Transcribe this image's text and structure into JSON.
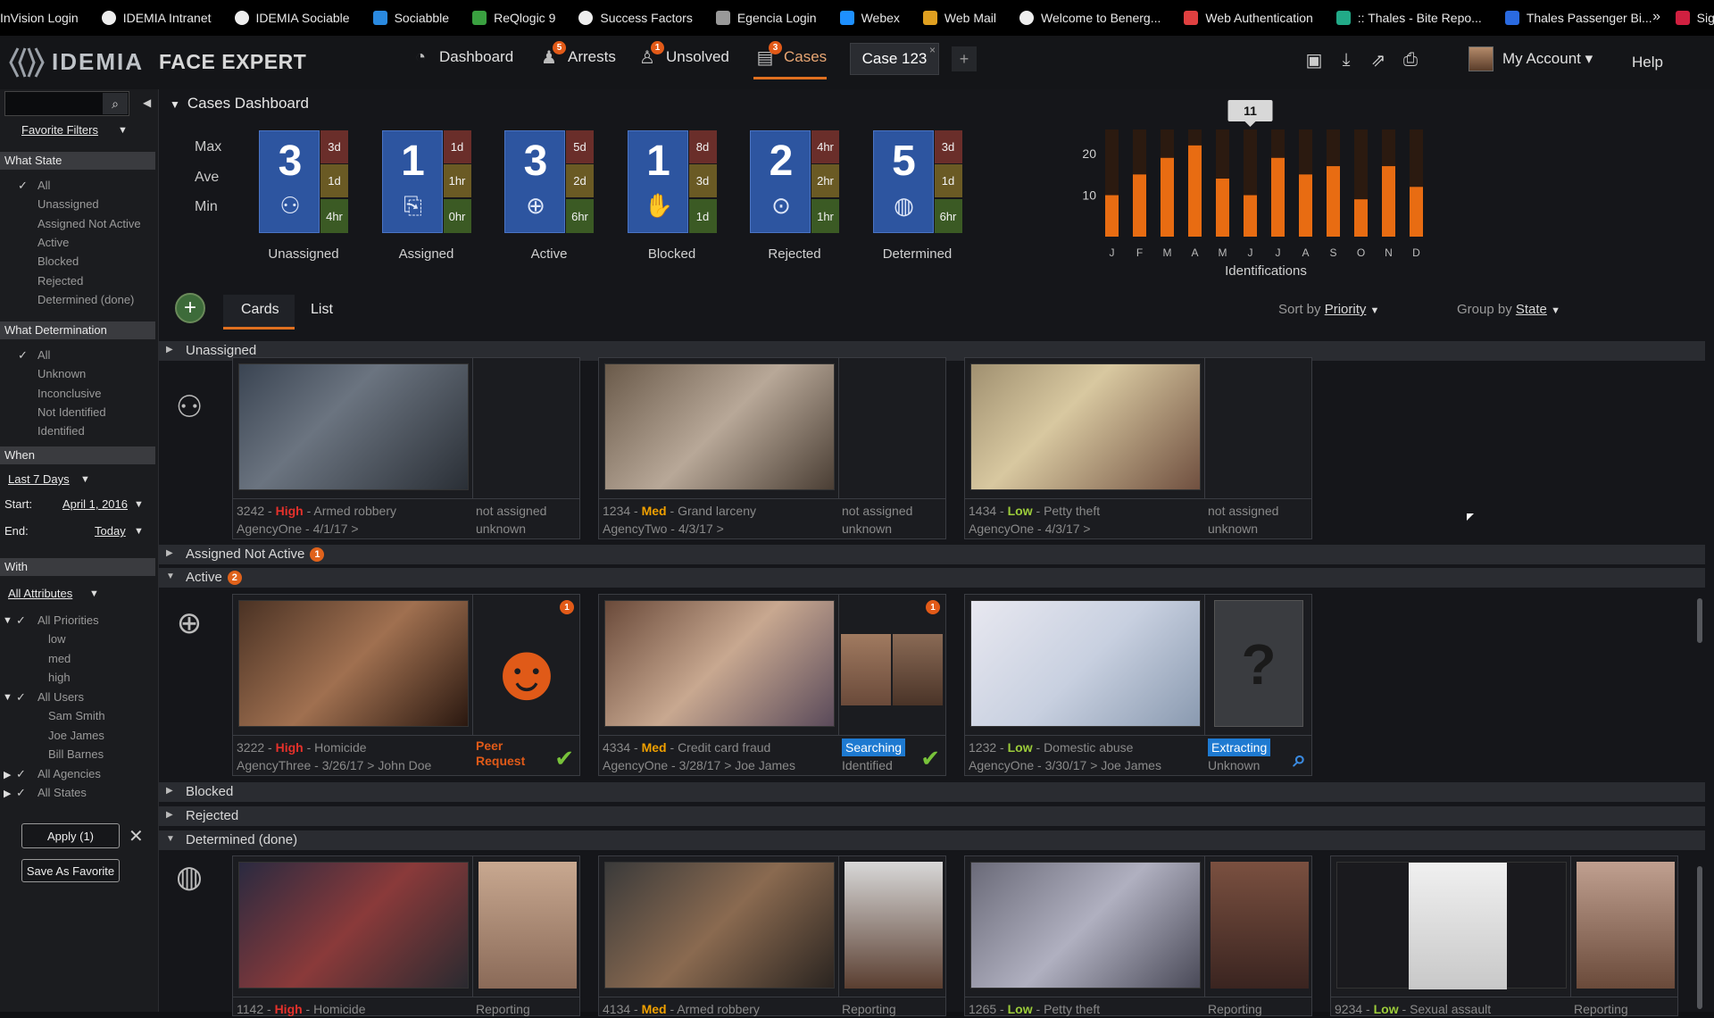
{
  "bookmarks": [
    {
      "label": "InVision Login",
      "color": "#000000"
    },
    {
      "label": "IDEMIA Intranet",
      "color": "#eeeeee"
    },
    {
      "label": "IDEMIA Sociable",
      "color": "#eeeeee"
    },
    {
      "label": "Sociabble",
      "color": "#2a8ae0"
    },
    {
      "label": "ReQlogic 9",
      "color": "#3aa040"
    },
    {
      "label": "Success Factors",
      "color": "#eeeeee"
    },
    {
      "label": "Egencia Login",
      "color": "#999999"
    },
    {
      "label": "Webex",
      "color": "#1e90ff"
    },
    {
      "label": "Web Mail",
      "color": "#e0a020"
    },
    {
      "label": "Welcome to Benerg...",
      "color": "#eeeeee"
    },
    {
      "label": "Web Authentication",
      "color": "#e04040"
    },
    {
      "label": ":: Thales - Bite Repo...",
      "color": "#22aa88"
    },
    {
      "label": "Thales Passenger Bi...",
      "color": "#2a6ae0"
    },
    {
      "label": "Sign in",
      "color": "#d02040"
    }
  ],
  "bookmarks_more": "»",
  "header": {
    "logo": "IDEMIA",
    "product": "FACE EXPERT",
    "nav": [
      {
        "label": "Dashboard",
        "icon": "dashboard-icon",
        "badge": ""
      },
      {
        "label": "Arrests",
        "icon": "arrests-icon",
        "badge": "5"
      },
      {
        "label": "Unsolved",
        "icon": "unsolved-icon",
        "badge": "1"
      },
      {
        "label": "Cases",
        "icon": "cases-icon",
        "badge": "3"
      }
    ],
    "case_tab": "Case 123",
    "case_tab_close": "×",
    "new_tab": "+",
    "account": "My Account ▾",
    "help": "Help"
  },
  "sidebar": {
    "favorite_filters": "Favorite Filters",
    "what_state": "What State",
    "state_items": [
      "All",
      "Unassigned",
      "Assigned Not Active",
      "Active",
      "Blocked",
      "Rejected",
      "Determined (done)"
    ],
    "what_determination": "What Determination",
    "determination_items": [
      "All",
      "Unknown",
      "Inconclusive",
      "Not Identified",
      "Identified"
    ],
    "when": "When",
    "range": "Last 7 Days",
    "start_label": "Start:",
    "start_value": "April 1, 2016",
    "end_label": "End:",
    "end_value": "Today",
    "with": "With",
    "attributes": "All Attributes",
    "priorities": "All Priorities",
    "priority_items": [
      "low",
      "med",
      "high"
    ],
    "users": "All Users",
    "user_items": [
      "Sam Smith",
      "Joe James",
      "Bill Barnes"
    ],
    "agencies": "All Agencies",
    "states": "All States",
    "apply": "Apply (1)",
    "clear": "✕",
    "save_favorite": "Save As Favorite"
  },
  "dashboard": {
    "title": "Cases Dashboard",
    "row_labels": [
      "Max",
      "Ave",
      "Min"
    ],
    "states": [
      {
        "name": "Unassigned",
        "count": "3",
        "max": "3d",
        "ave": "1d",
        "min": "4hr",
        "icon": "unassigned-icon"
      },
      {
        "name": "Assigned",
        "count": "1",
        "max": "1d",
        "ave": "1hr",
        "min": "0hr",
        "icon": "assigned-icon"
      },
      {
        "name": "Active",
        "count": "3",
        "max": "5d",
        "ave": "2d",
        "min": "6hr",
        "icon": "active-search-icon"
      },
      {
        "name": "Blocked",
        "count": "1",
        "max": "8d",
        "ave": "3d",
        "min": "1d",
        "icon": "blocked-hand-icon"
      },
      {
        "name": "Rejected",
        "count": "2",
        "max": "4hr",
        "ave": "2hr",
        "min": "1hr",
        "icon": "rejected-thumb-icon"
      },
      {
        "name": "Determined",
        "count": "5",
        "max": "3d",
        "ave": "1d",
        "min": "6hr",
        "icon": "determined-thumb-icon"
      }
    ]
  },
  "chart_data": {
    "type": "bar",
    "categories": [
      "J",
      "F",
      "M",
      "A",
      "M",
      "J",
      "J",
      "A",
      "S",
      "O",
      "N",
      "D"
    ],
    "values": [
      10,
      15,
      19,
      22,
      14,
      10,
      19,
      15,
      17,
      9,
      17,
      12
    ],
    "xlabel": "Identifications",
    "ylabel": "",
    "yticks": [
      10,
      20
    ],
    "ylim": [
      0,
      28
    ],
    "tooltip": "11",
    "colors": {
      "bar": "#e86c12",
      "bg_bar": "#2b1a10"
    }
  },
  "toolbar": {
    "add": "+",
    "tab_cards": "Cards",
    "tab_list": "List",
    "sort_label": "Sort by",
    "sort_value": "Priority",
    "group_label": "Group by",
    "group_value": "State"
  },
  "groups": {
    "unassigned": {
      "label": "Unassigned",
      "badge": ""
    },
    "assigned_not_active": {
      "label": "Assigned Not Active",
      "badge": "1"
    },
    "active": {
      "label": "Active",
      "badge": "2"
    },
    "blocked": {
      "label": "Blocked",
      "badge": ""
    },
    "rejected": {
      "label": "Rejected",
      "badge": ""
    },
    "determined": {
      "label": "Determined (done)",
      "badge": ""
    }
  },
  "unassigned_cards": [
    {
      "id": "3242",
      "priority": "High",
      "crime": "Armed robbery",
      "agency": "AgencyOne - 4/1/17 >",
      "status1": "not assigned",
      "status2": "unknown"
    },
    {
      "id": "1234",
      "priority": "Med",
      "crime": "Grand larceny",
      "agency": "AgencyTwo - 4/3/17 >",
      "status1": "not assigned",
      "status2": "unknown"
    },
    {
      "id": "1434",
      "priority": "Low",
      "crime": "Petty theft",
      "agency": "AgencyOne - 4/3/17 >",
      "status1": "not assigned",
      "status2": "unknown"
    }
  ],
  "active_cards": [
    {
      "id": "3222",
      "priority": "High",
      "crime": "Homicide",
      "agency": "AgencyThree - 3/26/17 > John Doe",
      "status1": "Peer",
      "status2": "Request",
      "badge": "1"
    },
    {
      "id": "4334",
      "priority": "Med",
      "crime": "Credit card fraud",
      "agency": "AgencyOne - 3/28/17 > Joe James",
      "status1": "Searching",
      "status2": "Identified",
      "badge": "1"
    },
    {
      "id": "1232",
      "priority": "Low",
      "crime": "Domestic abuse",
      "agency": "AgencyOne - 3/30/17 > Joe James",
      "status1": "Extracting",
      "status2": "Unknown",
      "badge": ""
    }
  ],
  "determined_cards": [
    {
      "id": "1142",
      "priority": "High",
      "crime": "Homicide",
      "status1": "Reporting"
    },
    {
      "id": "4134",
      "priority": "Med",
      "crime": "Armed robbery",
      "status1": "Reporting"
    },
    {
      "id": "1265",
      "priority": "Low",
      "crime": "Petty theft",
      "status1": "Reporting"
    },
    {
      "id": "9234",
      "priority": "Low",
      "crime": "Sexual assault",
      "status1": "Reporting"
    }
  ]
}
